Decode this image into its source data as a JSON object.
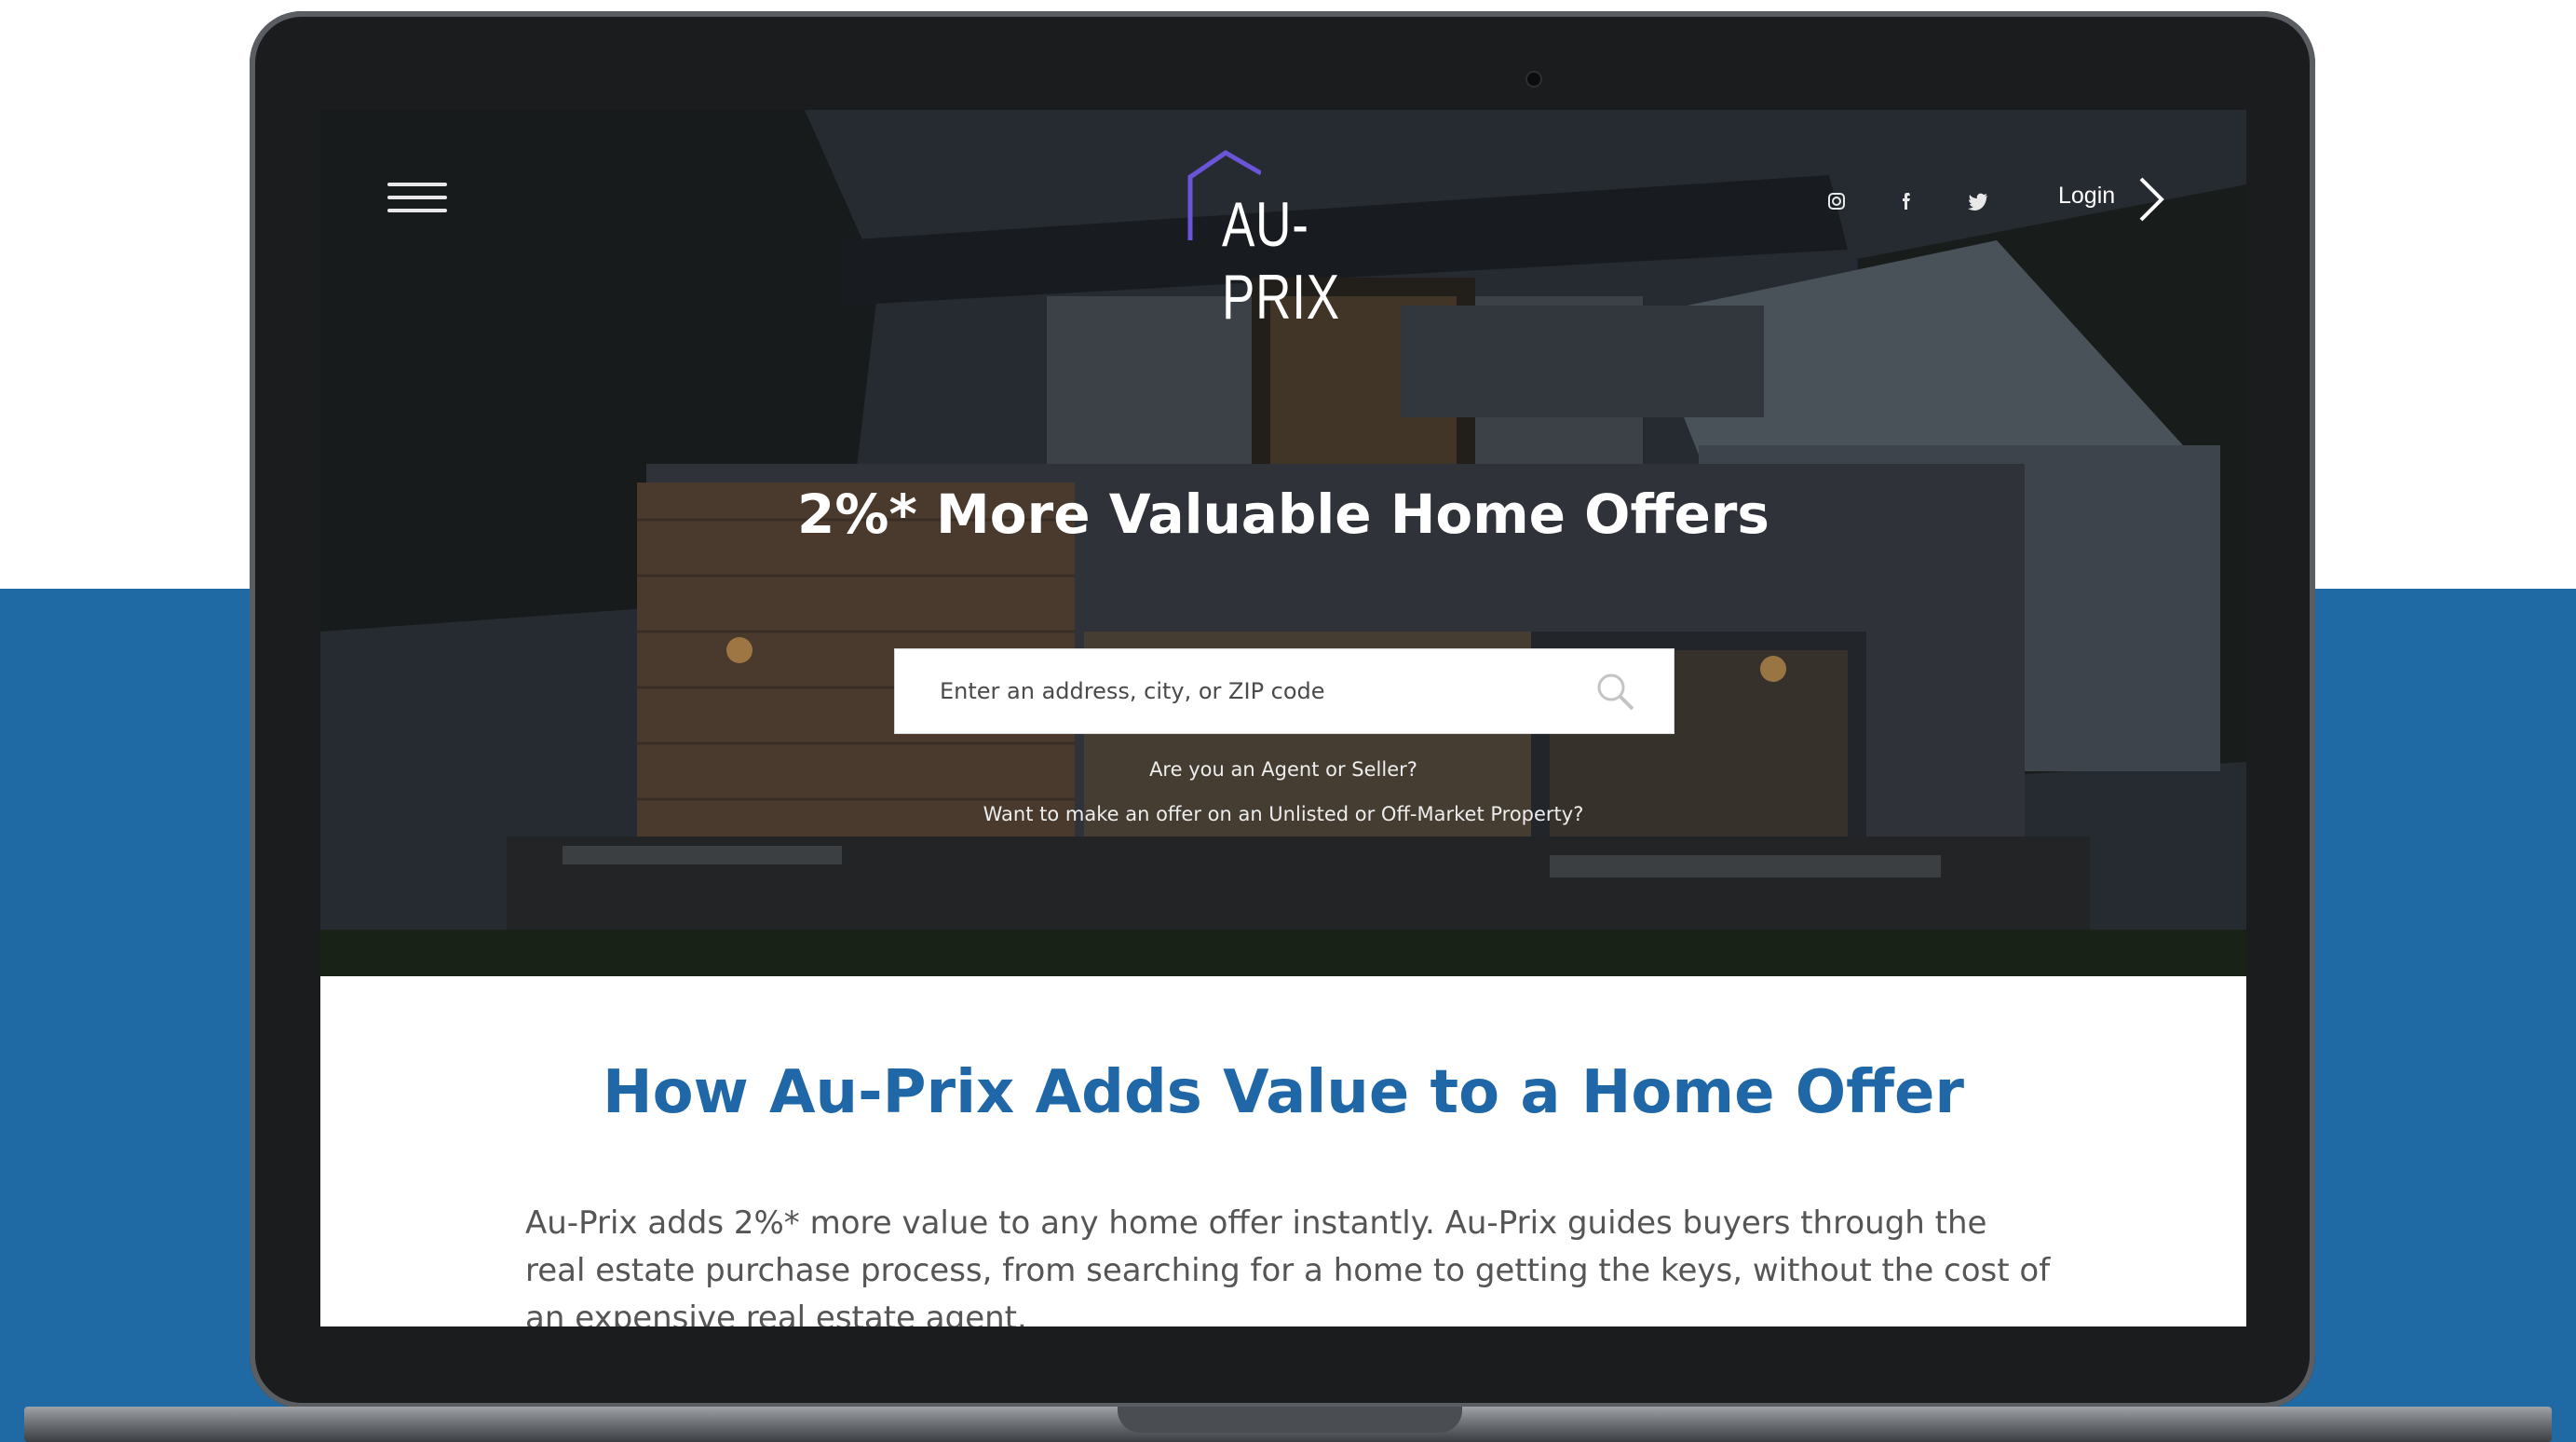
{
  "site": {
    "logo_text": "AU-PRIX",
    "menu_icon": "hamburger-menu-icon",
    "social_links": [
      {
        "name": "instagram",
        "icon": "instagram-icon"
      },
      {
        "name": "facebook",
        "icon": "facebook-icon"
      },
      {
        "name": "twitter",
        "icon": "twitter-icon"
      }
    ],
    "login_label": "Login",
    "login_icon": "chevron-right-icon"
  },
  "hero": {
    "title": "2%* More Valuable Home Offers",
    "search": {
      "placeholder": "Enter an address, city, or ZIP code",
      "value": "",
      "icon": "search-icon"
    },
    "links": [
      "Are you an Agent or Seller?",
      "Want to make an offer on an Unlisted or Off-Market Property?"
    ]
  },
  "content": {
    "title": "How Au-Prix Adds Value to a Home Offer",
    "paragraph": "Au-Prix adds 2%* more value to any home offer instantly. Au-Prix guides buyers through the real estate purchase process, from searching for a home to getting the keys, without the cost of an expensive real estate agent."
  },
  "colors": {
    "brand_blue": "#1f67a6",
    "background_band": "#1f6aa5",
    "logo_accent": "#6a54d8",
    "laptop_bezel": "#1b1c1e"
  }
}
